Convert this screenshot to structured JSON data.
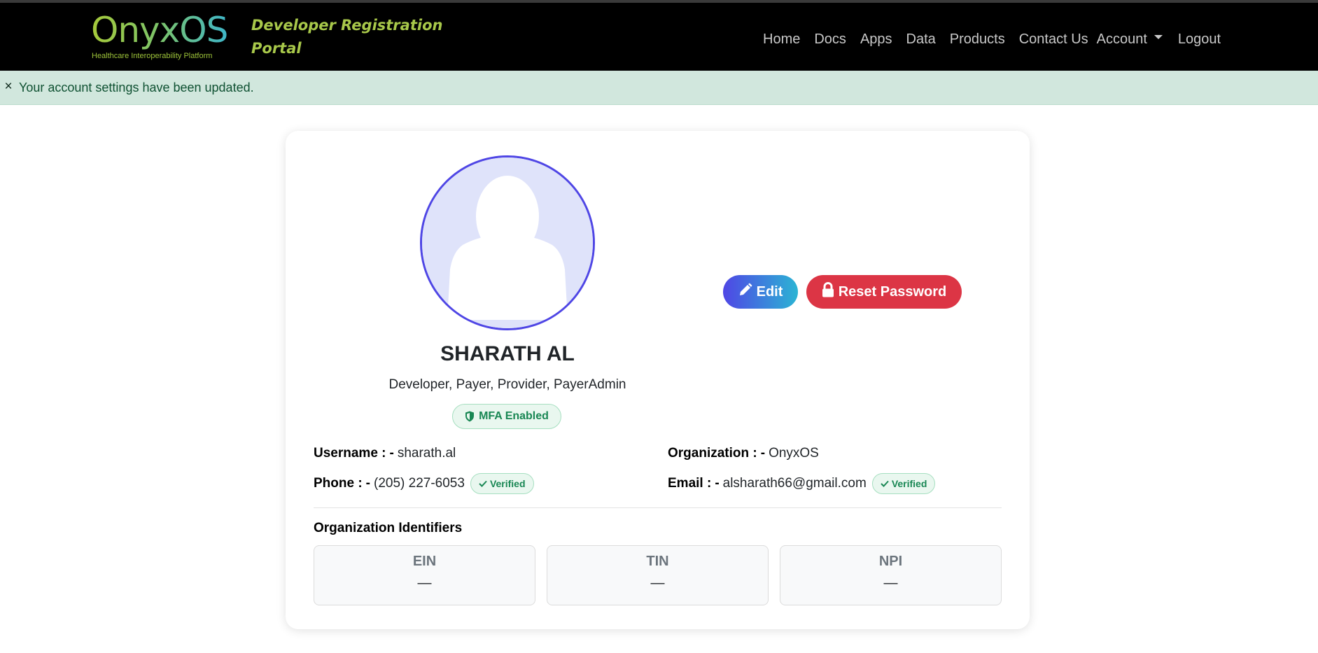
{
  "brand": {
    "name": "OnyxOS",
    "tagline": "Healthcare Interoperability Platform"
  },
  "portal_title": "Developer Registration Portal",
  "nav": {
    "home": "Home",
    "docs": "Docs",
    "apps": "Apps",
    "data": "Data",
    "products": "Products",
    "contact": "Contact Us",
    "account": "Account",
    "logout": "Logout"
  },
  "alert": {
    "close": "×",
    "message": "Your account settings have been updated."
  },
  "profile": {
    "name": "SHARATH AL",
    "roles": "Developer, Payer, Provider, PayerAdmin",
    "mfa_badge": "MFA Enabled",
    "edit_label": "Edit",
    "reset_label": "Reset Password",
    "username_label": "Username :",
    "username": "sharath.al",
    "organization_label": "Organization :",
    "organization": "OnyxOS",
    "phone_label": "Phone :",
    "phone": "(205) 227-6053",
    "email_label": "Email :",
    "email": "alsharath66@gmail.com",
    "separator": "-",
    "verified": "Verified"
  },
  "identifiers": {
    "title": "Organization Identifiers",
    "items": [
      {
        "label": "EIN",
        "value": "—"
      },
      {
        "label": "TIN",
        "value": "—"
      },
      {
        "label": "NPI",
        "value": "—"
      }
    ]
  },
  "colors": {
    "accent": "#4f46e5",
    "danger": "#dc3545",
    "success": "#198754",
    "alert_bg": "#d1e7dd",
    "brand_green": "#a8c84a"
  }
}
